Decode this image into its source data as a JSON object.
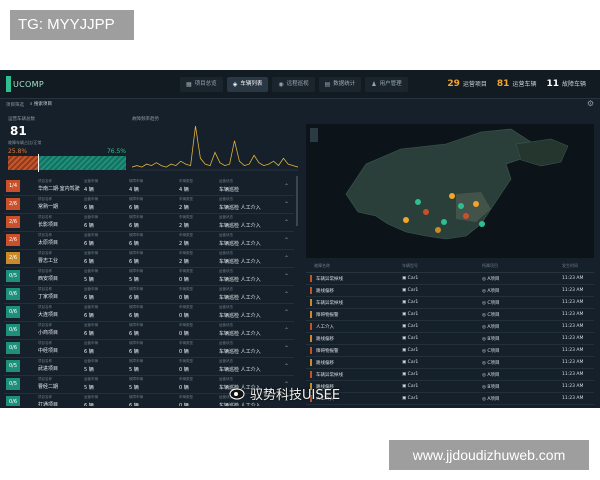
{
  "overlay": {
    "tg_label": "TG: MYYJJPP",
    "footer_url": "www.jjdoudizhuweb.com",
    "watermark": "驭势科技UISEE"
  },
  "app": {
    "logo_text": "UCOMP",
    "nav_tabs": [
      {
        "label": "项目总览",
        "icon": "grid-icon",
        "active": false
      },
      {
        "label": "车辆列表",
        "icon": "car-icon",
        "active": true
      },
      {
        "label": "远程巡视",
        "icon": "eye-icon",
        "active": false
      },
      {
        "label": "数据统计",
        "icon": "chart-icon",
        "active": false
      },
      {
        "label": "用户管理",
        "icon": "user-icon",
        "active": false
      }
    ],
    "stats": [
      {
        "value": "29",
        "label": "运营项目",
        "color": "#f3a52b"
      },
      {
        "value": "81",
        "label": "运营车辆",
        "color": "#f3a52b"
      },
      {
        "value": "11",
        "label": "故障车辆",
        "color": "#ffffff"
      }
    ],
    "subbar": {
      "label": "项目筛选",
      "search": "搜索项目"
    },
    "kpi": {
      "label": "运营车辆总数",
      "value": "81",
      "label2": "故障车辆占比/正常",
      "pct_left": "25.8%",
      "pct_right": "76.5%",
      "fault_fraction": 0.258
    },
    "spark": {
      "label": "故障频率趋势",
      "values": [
        2,
        3,
        2,
        4,
        3,
        5,
        3,
        2,
        4,
        3,
        6,
        4,
        3,
        30,
        8,
        4,
        3,
        12,
        5,
        3,
        4,
        20,
        6,
        3,
        4,
        10,
        5,
        3,
        4,
        6,
        3,
        8,
        4,
        3,
        2
      ]
    },
    "list_captions": {
      "project": "项目名称",
      "fleet": "运营车辆",
      "fault": "故障车辆",
      "type": "车辆类型",
      "state": "运营状态"
    },
    "projects": [
      {
        "badge": "1/4",
        "color": "#c9502a",
        "name": "华南二期·室内驾驶",
        "fleet": "4 辆",
        "fault": "4 辆",
        "type": "4 辆",
        "state": "车辆巡检"
      },
      {
        "badge": "2/6",
        "color": "#c9502a",
        "name": "常熟一期",
        "fleet": "6 辆",
        "fault": "6 辆",
        "type": "2 辆",
        "state": "车辆巡检  人工介入"
      },
      {
        "badge": "2/6",
        "color": "#c9502a",
        "name": "长影项目",
        "fleet": "6 辆",
        "fault": "6 辆",
        "type": "2 辆",
        "state": "车辆巡检  人工介入"
      },
      {
        "badge": "2/6",
        "color": "#c9502a",
        "name": "太原项目",
        "fleet": "6 辆",
        "fault": "6 辆",
        "type": "2 辆",
        "state": "车辆巡检  人工介入"
      },
      {
        "badge": "2/6",
        "color": "#c98b2a",
        "name": "曹志工业",
        "fleet": "6 辆",
        "fault": "6 辆",
        "type": "2 辆",
        "state": "车辆巡检  人工介入"
      },
      {
        "badge": "0/5",
        "color": "#1e8f79",
        "name": "西安项目",
        "fleet": "5 辆",
        "fault": "5 辆",
        "type": "0 辆",
        "state": "车辆巡检  人工介入"
      },
      {
        "badge": "0/6",
        "color": "#1e8f79",
        "name": "丁家项目",
        "fleet": "6 辆",
        "fault": "6 辆",
        "type": "0 辆",
        "state": "车辆巡检  人工介入"
      },
      {
        "badge": "0/6",
        "color": "#1e8f79",
        "name": "大连项目",
        "fleet": "6 辆",
        "fault": "6 辆",
        "type": "0 辆",
        "state": "车辆巡检  人工介入"
      },
      {
        "badge": "0/6",
        "color": "#1e8f79",
        "name": "小商项目",
        "fleet": "6 辆",
        "fault": "6 辆",
        "type": "0 辆",
        "state": "车辆巡检  人工介入"
      },
      {
        "badge": "0/6",
        "color": "#1e8f79",
        "name": "中经项目",
        "fleet": "6 辆",
        "fault": "6 辆",
        "type": "0 辆",
        "state": "车辆巡检  人工介入"
      },
      {
        "badge": "0/5",
        "color": "#1e8f79",
        "name": "武进项目",
        "fleet": "5 辆",
        "fault": "5 辆",
        "type": "0 辆",
        "state": "车辆巡检  人工介入"
      },
      {
        "badge": "0/5",
        "color": "#1e8f79",
        "name": "曹经二期",
        "fleet": "5 辆",
        "fault": "5 辆",
        "type": "0 辆",
        "state": "车辆巡检  人工介入"
      },
      {
        "badge": "0/6",
        "color": "#1e8f79",
        "name": "打通项目",
        "fleet": "6 辆",
        "fault": "6 辆",
        "type": "0 辆",
        "state": "车辆巡检  人工介入"
      }
    ],
    "table_headers": [
      "故障名称",
      "车辆型号",
      "所属项目",
      "发生时间"
    ],
    "faults": [
      {
        "color": "#c9502a",
        "name": "车辆异常掉线",
        "car": "Car1",
        "proj": "A项目",
        "time": "11:23 AM"
      },
      {
        "color": "#c9502a",
        "name": "路线偏移",
        "car": "Car1",
        "proj": "A项目",
        "time": "11:23 AM"
      },
      {
        "color": "#c98b2a",
        "name": "车辆异常掉线",
        "car": "Car1",
        "proj": "C项目",
        "time": "11:23 AM"
      },
      {
        "color": "#c98b2a",
        "name": "障碍物报警",
        "car": "Car1",
        "proj": "C项目",
        "time": "11:23 AM"
      },
      {
        "color": "#c9502a",
        "name": "人工介入",
        "car": "Car1",
        "proj": "A项目",
        "time": "11:23 AM"
      },
      {
        "color": "#c98b2a",
        "name": "路线偏移",
        "car": "Car1",
        "proj": "B项目",
        "time": "11:23 AM"
      },
      {
        "color": "#c9502a",
        "name": "障碍物报警",
        "car": "Car1",
        "proj": "C项目",
        "time": "11:23 AM"
      },
      {
        "color": "#c98b2a",
        "name": "路线偏移",
        "car": "Car1",
        "proj": "C项目",
        "time": "11:23 AM"
      },
      {
        "color": "#c9502a",
        "name": "车辆异常掉线",
        "car": "Car1",
        "proj": "A项目",
        "time": "11:23 AM"
      },
      {
        "color": "#c98b2a",
        "name": "路线偏移",
        "car": "Car1",
        "proj": "B项目",
        "time": "11:23 AM"
      },
      {
        "color": "#c9502a",
        "name": "人工介入",
        "car": "Car1",
        "proj": "A项目",
        "time": "11:23 AM"
      }
    ]
  }
}
